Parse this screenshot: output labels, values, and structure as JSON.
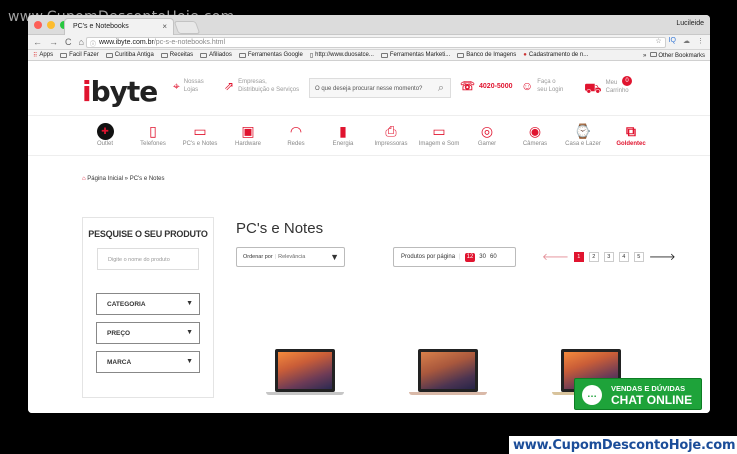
{
  "watermark_top": "www.CupomDescontoHoje.com",
  "watermark_bottom": "www.CupomDescontoHoje.com",
  "browser": {
    "tab_title": "PC's e Notebooks",
    "profile": "Lucileide",
    "url_host": "www.ibyte.com.br",
    "url_path": "/pc-s-e-notebooks.html",
    "colors": {
      "close": "#fd5f57",
      "min": "#fdbc2e",
      "max": "#28c840"
    },
    "bookmarks": [
      "Apps",
      "Facil Fazer",
      "Curitiba Antiga",
      "Receitas",
      "Afiliados",
      "Ferramentas Google",
      "http://www.duosatce...",
      "Ferramentas Marketi...",
      "Banco de Imagens",
      "Cadastramento de n..."
    ],
    "bookmarks_more": "»",
    "other_bookmarks": "Other Bookmarks"
  },
  "header": {
    "logo_i": "i",
    "logo_rest": "byte",
    "stores": [
      "Nossas",
      "Lojas"
    ],
    "business": [
      "Empresas,",
      "Distribuição e Serviços"
    ],
    "search_placeholder": "O que deseja procurar nesse momento?",
    "phone": "4020-5000",
    "login": [
      "Faça o",
      "seu Login"
    ],
    "cart": [
      "Meu",
      "Carrinho"
    ],
    "cart_count": "0"
  },
  "categories": [
    {
      "label": "Outlet"
    },
    {
      "label": "Telefones"
    },
    {
      "label": "PC's e Notes"
    },
    {
      "label": "Hardware"
    },
    {
      "label": "Redes"
    },
    {
      "label": "Energia"
    },
    {
      "label": "Impressoras"
    },
    {
      "label": "Imagem e Som"
    },
    {
      "label": "Gamer"
    },
    {
      "label": "Câmeras"
    },
    {
      "label": "Casa e Lazer"
    },
    {
      "label": "Goldentec"
    }
  ],
  "breadcrumb": {
    "home": "Página Inicial",
    "sep": "»",
    "current": "PC's e Notes"
  },
  "sidebar": {
    "title": "PESQUISE O SEU PRODUTO",
    "input_placeholder": "Digite o nome do produto",
    "filters": [
      "CATEGORIA",
      "PREÇO",
      "MARCA"
    ]
  },
  "listing": {
    "title": "PC's e Notes",
    "order_label": "Ordenar por",
    "order_value": "Relevância",
    "per_page_label": "Produtos por página",
    "per_page_options": [
      "12",
      "30",
      "60"
    ],
    "pages": [
      "1",
      "2",
      "3",
      "4",
      "5"
    ]
  },
  "chat": {
    "line1": "VENDAS E DÚVIDAS",
    "line2": "CHAT ONLINE"
  }
}
